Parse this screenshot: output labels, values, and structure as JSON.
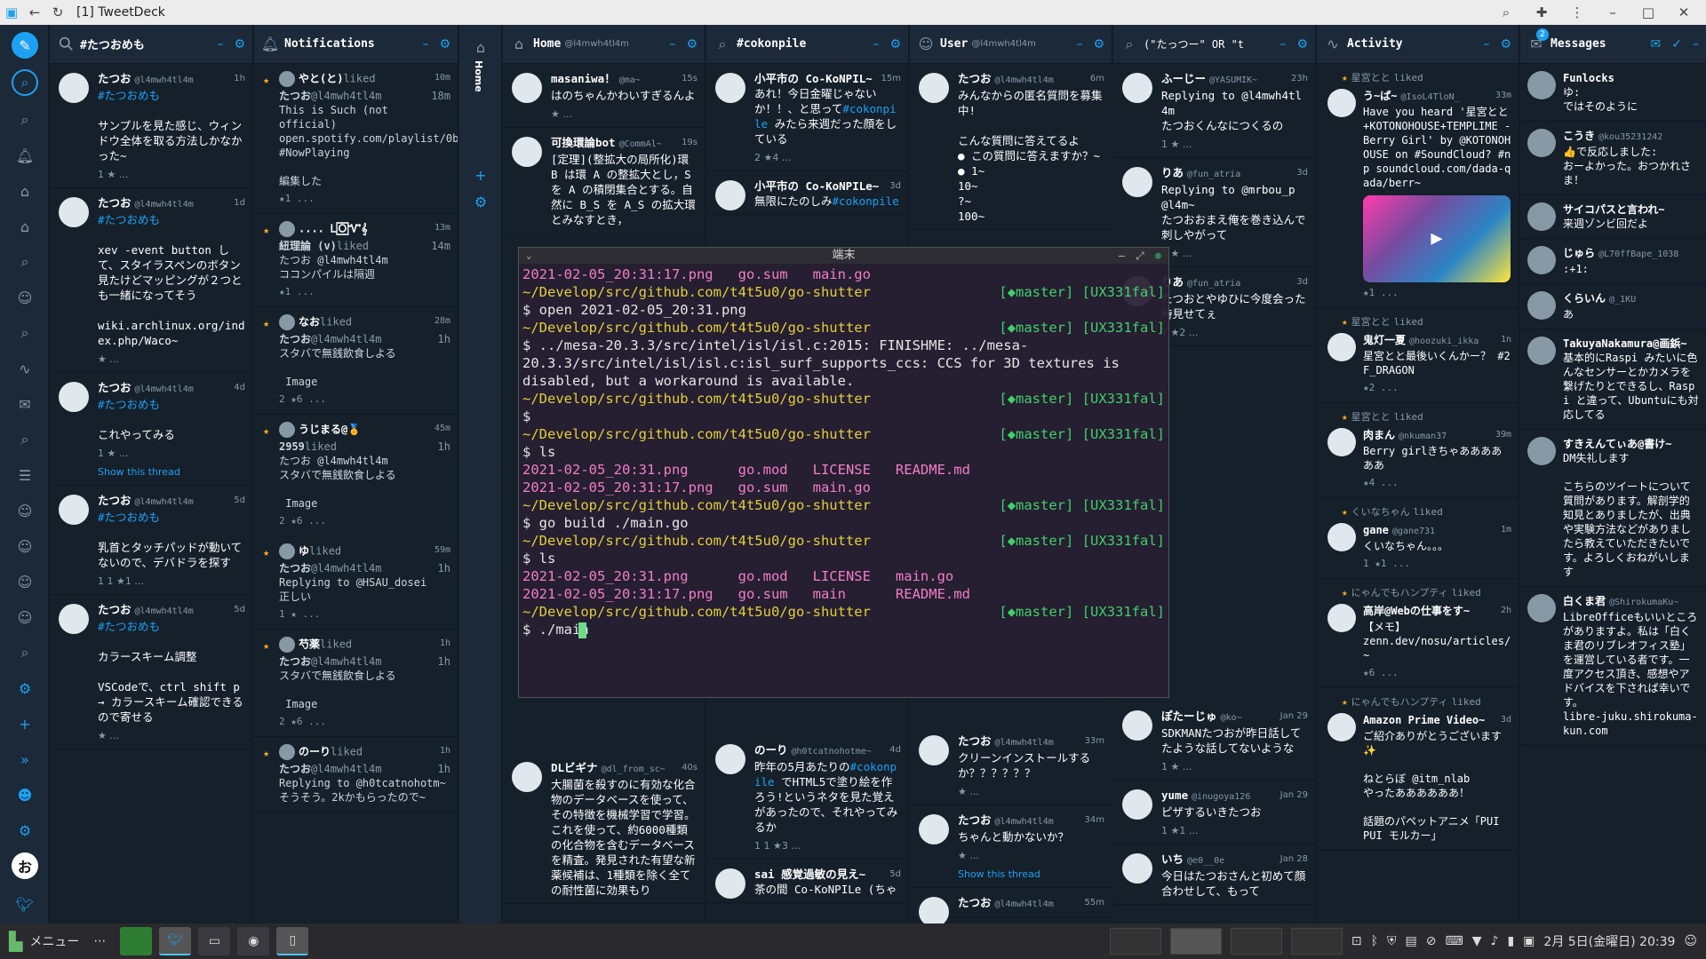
{
  "window": {
    "title": "[1] TweetDeck"
  },
  "columns": {
    "search1": {
      "title": "#たつおめも"
    },
    "notifications": {
      "title": "Notifications"
    },
    "home": {
      "title": "Home",
      "user": "@l4mwh4tl4m"
    },
    "search2": {
      "title": "#cokonpile"
    },
    "user": {
      "title": "User",
      "user": "@l4mwh4tl4m"
    },
    "search3": {
      "title": "(\"たっつー\" OR \"t"
    },
    "activity": {
      "title": "Activity"
    },
    "messages": {
      "title": "Messages",
      "badge": "2"
    }
  },
  "col1_tweets": [
    {
      "name": "たつお",
      "handle": "@l4mwh4tl4m",
      "time": "1h",
      "tag": "#たつおめも",
      "text": "サンプルを見た感じ、ウィンドウ全体を取る方法しかなかった~",
      "acts": "1   ★  ..."
    },
    {
      "name": "たつお",
      "handle": "@l4mwh4tl4m",
      "time": "1d",
      "tag": "#たつおめも",
      "text": "xev -event button して、スタイラスペンのボタン見たけどマッピングが２つとも一緒になってそう\n\nwiki.archlinux.org/index.php/Waco~",
      "acts": "  ★  ..."
    },
    {
      "name": "たつお",
      "handle": "@l4mwh4tl4m",
      "time": "4d",
      "tag": "#たつおめも",
      "text": "これやってみる",
      "acts": "1   ★  ...",
      "thread": "Show this thread"
    },
    {
      "name": "たつお",
      "handle": "@l4mwh4tl4m",
      "time": "5d",
      "tag": "#たつおめも",
      "text": "乳首とタッチパッドが動いてないので、デバドラを探す",
      "acts": "1 1 ★1 ..."
    },
    {
      "name": "たつお",
      "handle": "@l4mwh4tl4m",
      "time": "5d",
      "tag": "#たつおめも",
      "text": "カラースキーム調整\n\nVSCodeで、ctrl shift p → カラースキーム確認できるので寄せる",
      "acts": "  ★  ..."
    }
  ],
  "notifications": [
    {
      "who": "やと(と)",
      "action": "liked",
      "time": "10m",
      "qname": "たつお",
      "qhandle": "@l4mwh4tl4m",
      "qtime": "18m",
      "qtext": "This is Such (not official)\nopen.spotify.com/playlist/0bDtK~ #NowPlaying\n\n編集した",
      "acts": "  ★1 ..."
    },
    {
      "who": ".... Ꮮ🄾Ꮙ𝄞",
      "action": "",
      "time": "13m",
      "qname": "紐理論 (v)",
      "qhandle": "liked",
      "qtime": "14m",
      "qtext": "たつお @l4mwh4tl4m\nココンパイルは隔週",
      "acts": "  ★1 ..."
    },
    {
      "who": "なお",
      "action": "liked",
      "time": "28m",
      "qname": "たつお",
      "qhandle": "@l4mwh4tl4m",
      "qtime": "1h",
      "qtext": "スタバで無銭飲食しよる\n\n Image",
      "acts": "2   ★6 ..."
    },
    {
      "who": "うじまる@🏅",
      "action": "",
      "time": "45m",
      "qname": "2959",
      "qhandle": "liked",
      "qtime": "1h",
      "qtext": "たつお @l4mwh4tl4m\nスタバで無銭飲食しよる\n\n Image",
      "acts": "2   ★6 ..."
    },
    {
      "who": "ゆ",
      "action": "liked",
      "time": "59m",
      "qname": "たつお",
      "qhandle": "@l4mwh4tl4m",
      "qtime": "1h",
      "qtext": "Replying to @HSAU_dosei\n正しい",
      "acts": "1   ★  ..."
    },
    {
      "who": "芍薬",
      "action": "liked",
      "time": "1h",
      "qname": "たつお",
      "qhandle": "@l4mwh4tl4m",
      "qtime": "1h",
      "qtext": "スタバで無銭飲食しよる\n\n Image",
      "acts": "2   ★6 ..."
    },
    {
      "who": "のーり",
      "action": "liked",
      "time": "1h",
      "qname": "たつお",
      "qhandle": "@l4mwh4tl4m",
      "qtime": "1h",
      "qtext": "Replying to @h0tcatnohotm~\nそうそう。2kかもらったので~",
      "acts": ""
    }
  ],
  "home_tweets": [
    {
      "name": "masaniwa！",
      "handle": "@ma~",
      "time": "15s",
      "text": "はのちゃんかわいすぎるんよ",
      "acts": "  ★  ..."
    },
    {
      "name": "可換環論bot",
      "handle": "@CommAl~",
      "time": "19s",
      "text": "[定理](整拡大の局所化)環 B は環 A の整拡大とし，S を A の積閉集合とする。自然に B_S を A_S の拡大環とみなすとき，",
      "acts": ""
    }
  ],
  "home_bottom": [
    {
      "name": "DLビギナ",
      "handle": "@dl_from_sc~",
      "time": "40s",
      "text": "大腸菌を殺すのに有効な化合物のデータベースを使って、その特徴を機械学習で学習。これを使って、約6000種類の化合物を含むデータベースを精査。発見された有望な新薬候補は、1種類を除く全ての耐性菌に効果もり",
      "acts": ""
    }
  ],
  "cokon_tweets": [
    {
      "name": "小平市の Co-KoNPIL~",
      "handle": "",
      "time": "15m",
      "text": "あれ！今日金曜じゃないか！！、と思って",
      "tag": "#cokonpile",
      "text2": " みたら来週だった顔をしている",
      "acts": "2 ★4 ..."
    },
    {
      "name": "小平市の Co-KoNPILe~",
      "handle": "",
      "time": "3d",
      "text": "無限にたのしみ",
      "tag": "#cokonpile",
      "text2": "",
      "acts": ""
    }
  ],
  "cokon_bottom": [
    {
      "name": "のーり",
      "handle": "@h0tcatnohotme~",
      "time": "4d",
      "text": "昨年の5月あたりの",
      "tag": "#cokonpile",
      "text2": " でHTML5で塗り絵を作ろう!というネタを見た覚えがあったので、それやってみるか",
      "acts": "1 1 ★3 ..."
    },
    {
      "name": "sai 感覚過敏の見え~",
      "handle": "",
      "time": "5d",
      "text": "茶の間 Co-KoNPILe (ちゃ",
      "tag": "",
      "text2": "",
      "acts": ""
    }
  ],
  "user_tweets": [
    {
      "name": "たつお",
      "handle": "@l4mwh4tl4m",
      "time": "6m",
      "text": "みんなからの匿名質問を募集中!\n\nこんな質問に答えてるよ\n● この質問に答えますか？~\n● 1~\n10~\n?~\n100~",
      "acts": ""
    }
  ],
  "user_bottom": [
    {
      "name": "たつお",
      "handle": "@l4mwh4tl4m",
      "time": "33m",
      "text": "クリーンインストールするか？？？？？？",
      "acts": "  ★  ..."
    },
    {
      "name": "たつお",
      "handle": "@l4mwh4tl4m",
      "time": "34m",
      "text": "ちゃんと動かないか？",
      "acts": "  ★  ...",
      "thread": "Show this thread"
    },
    {
      "name": "たつお",
      "handle": "@l4mwh4tl4m",
      "time": "55m",
      "text": "",
      "acts": ""
    }
  ],
  "search3_tweets": [
    {
      "name": "ふーじー",
      "handle": "@YASUMIK~",
      "time": "23h",
      "text": "Replying to @l4mwh4tl4m\nたつおくんなにつくるの",
      "acts": "1   ★  ..."
    },
    {
      "name": "りあ",
      "handle": "@fun_atria",
      "time": "3d",
      "text": "Replying to @mrbou_p @l4m~\nたつおおまえ俺を巻き込んで刺しやがって",
      "acts": "1   ★  ..."
    },
    {
      "name": "りあ",
      "handle": "@fun_atria",
      "time": "3d",
      "text": "たつおとやゆひに今度会った時見せてぇ",
      "acts": "2 ★2 ..."
    }
  ],
  "search3_bottom": [
    {
      "name": "ぽたーじゅ",
      "handle": "@ko~",
      "time": "Jan 29",
      "text": "SDKMANたつおが昨日話してたような話してないような",
      "acts": "1   ★  ..."
    },
    {
      "name": "yume",
      "handle": "@inugoya126",
      "time": "Jan 29",
      "text": "ピザするいきたつお",
      "acts": "1   ★1 ..."
    },
    {
      "name": "いち",
      "handle": "@e0__0e",
      "time": "Jan 28",
      "text": "今日はたつおさんと初めて顔合わせして、もって",
      "acts": ""
    }
  ],
  "activity": [
    {
      "who": "星宮とと",
      "action": "liked",
      "name": "う~ぱ~",
      "handle": "@IsoL4TloN_",
      "time": "33m",
      "text": "Have you heard '星宮とと+KOTONOHOUSE+TEMPLIME - Berry Girl' by @KOTONOHOUSE on #SoundCloud? #np soundcloud.com/dada-qada/berr~",
      "acts": "  ★1 ..."
    },
    {
      "who": "星宮とと",
      "action": "liked",
      "name": "鬼灯一夏",
      "handle": "@hoozuki_ikka",
      "time": "1n",
      "text": "星宮とと最後いくんかー？ #2F_DRAGON",
      "acts": "  ★2 ..."
    },
    {
      "who": "星宮とと",
      "action": "liked",
      "name": "肉まん",
      "handle": "@nkuman37",
      "time": "39m",
      "text": "Berry girlきちゃああああああ",
      "acts": "  ★4 ..."
    },
    {
      "who": "くいなちゃん",
      "action": "liked",
      "name": "gane",
      "handle": "@gane731",
      "time": "1m",
      "text": "くいなちゃん。。。",
      "acts": "1 ★1 ..."
    },
    {
      "who": "にゃんでもハンプティ",
      "action": "liked",
      "name": "高岸@Webの仕事をす~",
      "handle": "",
      "time": "2h",
      "text": "【メモ】\nzenn.dev/nosu/articles/~",
      "acts": "  ★6 ..."
    },
    {
      "who": "にゃんでもハンプティ",
      "action": "liked",
      "name": "Amazon Prime Video~",
      "handle": "",
      "time": "3d",
      "text": "ご紹介ありがとうございます✨\n\nねとらぼ @itm_nlab\nやったああああああ！\n\n話題のパペットアニメ「PUI PUI モルカー」",
      "acts": ""
    }
  ],
  "messages": [
    {
      "name": "Funlocks",
      "handle": "",
      "text": "ゆ:\nではそのように"
    },
    {
      "name": "こうき",
      "handle": "@kou35231242",
      "text": "👍で反応しました:\nおーよかった。おつかれさま！"
    },
    {
      "name": "サイコパスと言われ~",
      "handle": "",
      "text": "来週ゾンビ回だよ"
    },
    {
      "name": "じゅら",
      "handle": "@L70ffBape_1038",
      "text": ":+1:"
    },
    {
      "name": "くらいん",
      "handle": "@_1KU",
      "text": "あ"
    },
    {
      "name": "TakuyaNakamura@画鋲~",
      "handle": "",
      "text": "基本的にRaspi みたいに色んなセンサーとかカメラを繋げたりとできるし、Raspi と違って、Ubuntuにも対応してる"
    },
    {
      "name": "すきえんてぃあ@書け~",
      "handle": "",
      "text": "DM失礼します\n\nこちらのツイートについて質問があります。解剖学的知見とありましたが、出典や実験方法などがありましたら教えていただきたいです。よろしくおねがいします"
    },
    {
      "name": "白くま君",
      "handle": "@ShirokumaKu~",
      "text": "LibreOfficeもいいところがありますよ。私は「白くま君のリブレオフィス塾」を運営している者です。一度アクセス頂き、感想やアドバイスを下されば幸いです。\nlibre-juku.shirokuma-kun.com"
    }
  ],
  "terminal": {
    "title": "端末",
    "lines": [
      {
        "t": "file",
        "v": "2021-02-05_20:31:17.png   go.sum   main.go"
      },
      {
        "t": "path",
        "v": "~/Develop/src/github.com/t4t5u0/go-shutter"
      },
      {
        "t": "cmd",
        "v": "$ open 2021-02-05_20:31.png"
      },
      {
        "t": "path",
        "v": "~/Develop/src/github.com/t4t5u0/go-shutter"
      },
      {
        "t": "cmd",
        "v": "$ ../mesa-20.3.3/src/intel/isl/isl.c:2015: FINISHME: ../mesa-20.3.3/src/intel/isl/isl.c:isl_surf_supports_ccs: CCS for 3D textures is disabled, but a workaround is available."
      },
      {
        "t": "path",
        "v": "~/Develop/src/github.com/t4t5u0/go-shutter"
      },
      {
        "t": "cmd",
        "v": "$"
      },
      {
        "t": "path",
        "v": "~/Develop/src/github.com/t4t5u0/go-shutter"
      },
      {
        "t": "cmd",
        "v": "$ ls"
      },
      {
        "t": "file",
        "v": "2021-02-05_20:31.png      go.mod   LICENSE   README.md"
      },
      {
        "t": "file",
        "v": "2021-02-05_20:31:17.png   go.sum   main.go"
      },
      {
        "t": "path",
        "v": "~/Develop/src/github.com/t4t5u0/go-shutter"
      },
      {
        "t": "cmd",
        "v": "$ go build ./main.go"
      },
      {
        "t": "path",
        "v": "~/Develop/src/github.com/t4t5u0/go-shutter"
      },
      {
        "t": "cmd",
        "v": "$ ls"
      },
      {
        "t": "file",
        "v": "2021-02-05_20:31.png      go.mod   LICENSE   main.go"
      },
      {
        "t": "file",
        "v": "2021-02-05_20:31:17.png   go.sum   main      README.md"
      },
      {
        "t": "path",
        "v": "~/Develop/src/github.com/t4t5u0/go-shutter"
      },
      {
        "t": "cmd",
        "v": "$ ./main"
      }
    ],
    "git": "[◆master] [UX331fal]"
  },
  "taskbar": {
    "menu": "メニュー",
    "clock": "2月 5日(金曜日) 20:39"
  }
}
